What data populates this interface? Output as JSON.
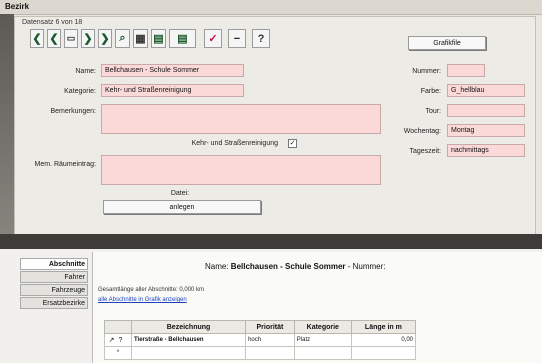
{
  "window": {
    "title": "Bezirk"
  },
  "record": {
    "info": "Datensatz 6 von 18"
  },
  "toolbar": {
    "first": "❮",
    "prev": "❮",
    "page": "▭",
    "next": "❯",
    "last": "❯",
    "search": "⌕",
    "grid": "▦",
    "list": "▤",
    "edit": "✓",
    "minus": "−",
    "help": "?"
  },
  "buttons": {
    "graphic": "Grafikfile",
    "show": "anlegen"
  },
  "form": {
    "name_label": "Name:",
    "name_value": "Bellchausen - Schule Sommer",
    "kategorie_label": "Kategorie:",
    "kategorie_value": "Kehr- und Straßenreinigung",
    "bemerkungen_label": "Bemerkungen:",
    "bemerkungen_value": "",
    "checkbox_label": "Kehr- und Straßenreinigung",
    "checkbox_value": "✓",
    "raum_label": "Mem. Räumeintrag:",
    "raum_value": "",
    "datei_label": "Datei:",
    "nummer_label": "Nummer:",
    "nummer_value": "",
    "farbe_label": "Farbe:",
    "farbe_value": "G_hellblau",
    "tour_label": "Tour:",
    "tour_value": "",
    "wochentag_label": "Wochentag:",
    "wochentag_value": "Montag",
    "tageszeit_label": "Tageszeit:",
    "tageszeit_value": "nachmittags"
  },
  "tabs": [
    {
      "label": "Abschnitte",
      "active": true
    },
    {
      "label": "Fahrer",
      "active": false
    },
    {
      "label": "Fahrzeuge",
      "active": false
    },
    {
      "label": "Ersatzbezirke",
      "active": false
    }
  ],
  "detail": {
    "name_prefix": "Name:",
    "name_value": "Bellchausen - Schule Sommer",
    "nummer_suffix": "- Nummer:",
    "summary": "Gesamtlänge aller Abschnitte: 0,000 km",
    "link": "alle Abschnitte in Grafik anzeigen"
  },
  "table": {
    "headers": [
      "Bezeichnung",
      "Priorität",
      "Kategorie",
      "Länge in m"
    ],
    "rows": [
      {
        "bezeichnung": "Tierstraße - Bellchausen",
        "prioritaet": "hoch",
        "kategorie": "Platz",
        "laenge": "0,00"
      }
    ],
    "new_row_marker": "*"
  }
}
